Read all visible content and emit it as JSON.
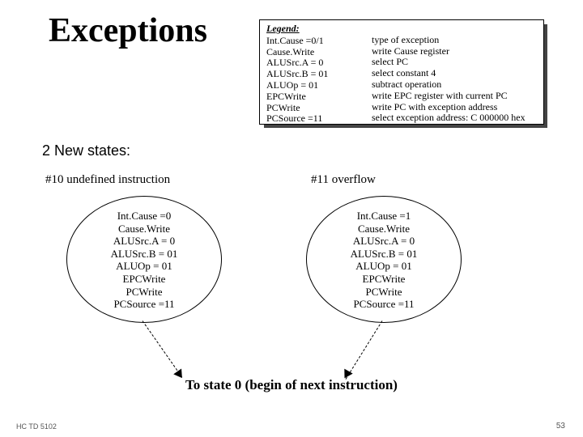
{
  "title": "Exceptions",
  "legend": {
    "heading": "Legend:",
    "left": [
      "Int.Cause =0/1",
      "Cause.Write",
      "ALUSrc.A = 0",
      "ALUSrc.B = 01",
      "ALUOp = 01",
      "EPCWrite",
      "PCWrite",
      "PCSource =11"
    ],
    "right": [
      "type of exception",
      "write Cause register",
      "select PC",
      "select constant 4",
      "subtract operation",
      "write EPC register with current PC",
      "write PC with exception address",
      "select exception address: C 000000 hex"
    ]
  },
  "subhead": "2 New states:",
  "state10": {
    "label": "#10 undefined instruction",
    "lines": [
      "Int.Cause =0",
      "Cause.Write",
      "ALUSrc.A = 0",
      "ALUSrc.B = 01",
      "ALUOp = 01",
      "EPCWrite",
      "PCWrite",
      "PCSource =11"
    ]
  },
  "state11": {
    "label": "#11 overflow",
    "lines": [
      "Int.Cause =1",
      "Cause.Write",
      "ALUSrc.A = 0",
      "ALUSrc.B = 01",
      "ALUOp = 01",
      "EPCWrite",
      "PCWrite",
      "PCSource =11"
    ]
  },
  "bottom": "To state 0 (begin of next instruction)",
  "footer_left": "HC TD 5102",
  "footer_right": "53"
}
